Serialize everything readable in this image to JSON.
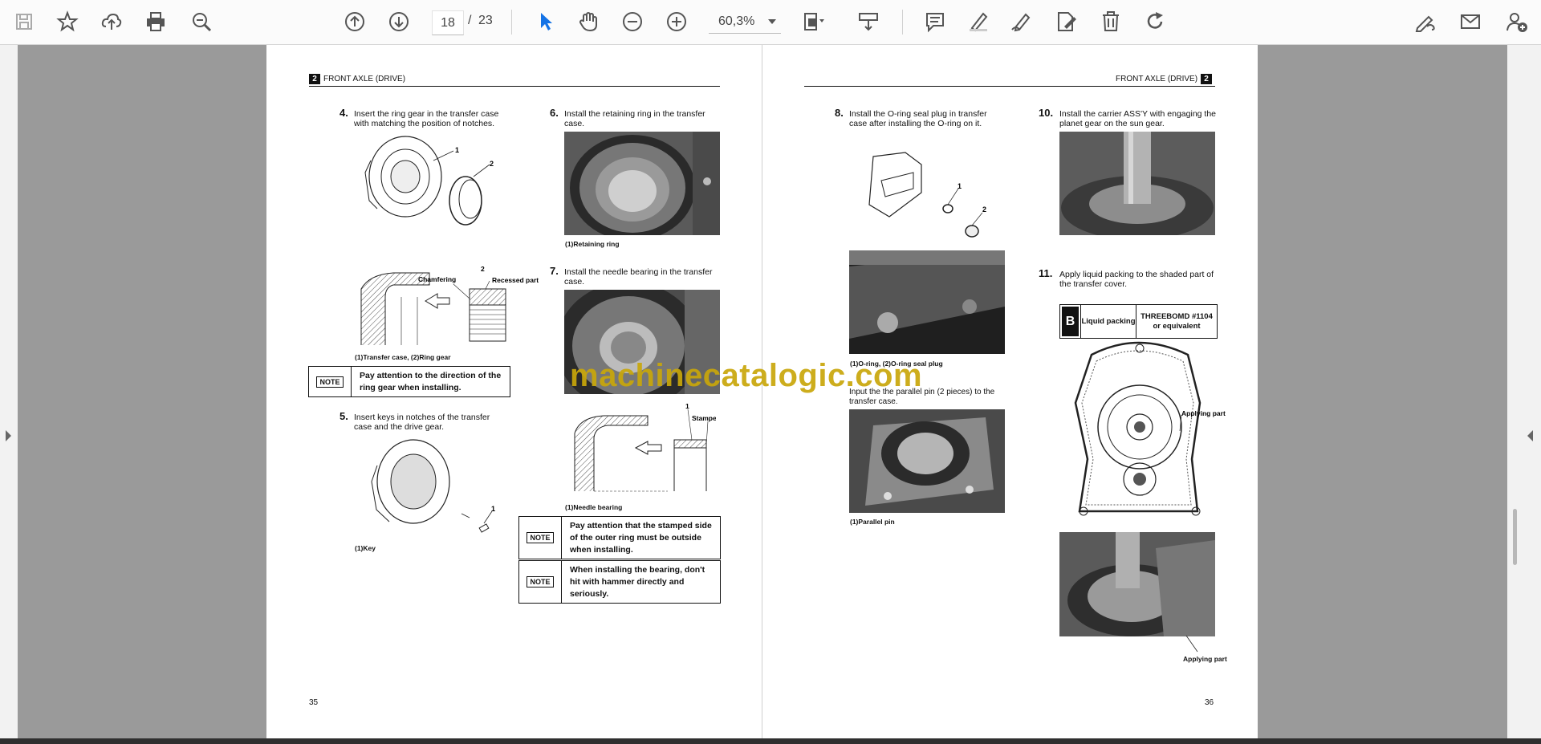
{
  "toolbar": {
    "current_page": "18",
    "page_separator": "/",
    "total_pages": "23",
    "zoom": "60,3%"
  },
  "left_page": {
    "header_num": "2",
    "header_title": "FRONT AXLE (DRIVE)",
    "page_number": "35",
    "step4_num": "4.",
    "step4_text": "Insert the ring gear in the transfer case with matching the position of notches.",
    "step4_caption": "(1)Transfer case, (2)Ring gear",
    "label_chamfering": "Chamfering",
    "label_recessed": "Recessed part",
    "label_1": "1",
    "label_2": "2",
    "note1_tag": "NOTE",
    "note1_text": "Pay attention to the direction of the ring gear when installing.",
    "step5_num": "5.",
    "step5_text": "Insert keys in notches of the transfer case and the drive gear.",
    "step5_caption": "(1)Key",
    "step6_num": "6.",
    "step6_text": "Install the retaining ring in the transfer case.",
    "step6_caption": "(1)Retaining ring",
    "step7_num": "7.",
    "step7_text": "Install the needle bearing in the transfer case.",
    "step7_caption": "(1)Needle bearing",
    "label_stamped": "Stamped side",
    "note2_tag": "NOTE",
    "note2_text": "Pay attention that the stamped side of the outer ring must be outside when installing.",
    "note3_tag": "NOTE",
    "note3_text": "When installing the bearing, don't hit with hammer directly and seriously."
  },
  "right_page": {
    "header_num": "2",
    "header_title": "FRONT AXLE (DRIVE)",
    "page_number": "36",
    "step8_num": "8.",
    "step8_text": "Install the O-ring seal plug in transfer case after installing the O-ring on it.",
    "step8_caption": "(1)O-ring, (2)O-ring seal plug",
    "step9_text": "Input the the parallel pin (2 pieces) to the transfer case.",
    "step9_caption": "(1)Parallel pin",
    "step10_num": "10.",
    "step10_text": "Install the carrier ASS'Y with engaging the planet gear on the sun gear.",
    "step11_num": "11.",
    "step11_text": "Apply liquid packing to the shaded part of the transfer cover.",
    "table_letter": "B",
    "table_col1": "Liquid packing",
    "table_col2": "THREEBOMD #1104 or equivalent",
    "label_applying1": "Applying part",
    "label_applying2": "Applying part",
    "label_1": "1",
    "label_2": "2"
  },
  "watermark": "machinecatalogic.com"
}
